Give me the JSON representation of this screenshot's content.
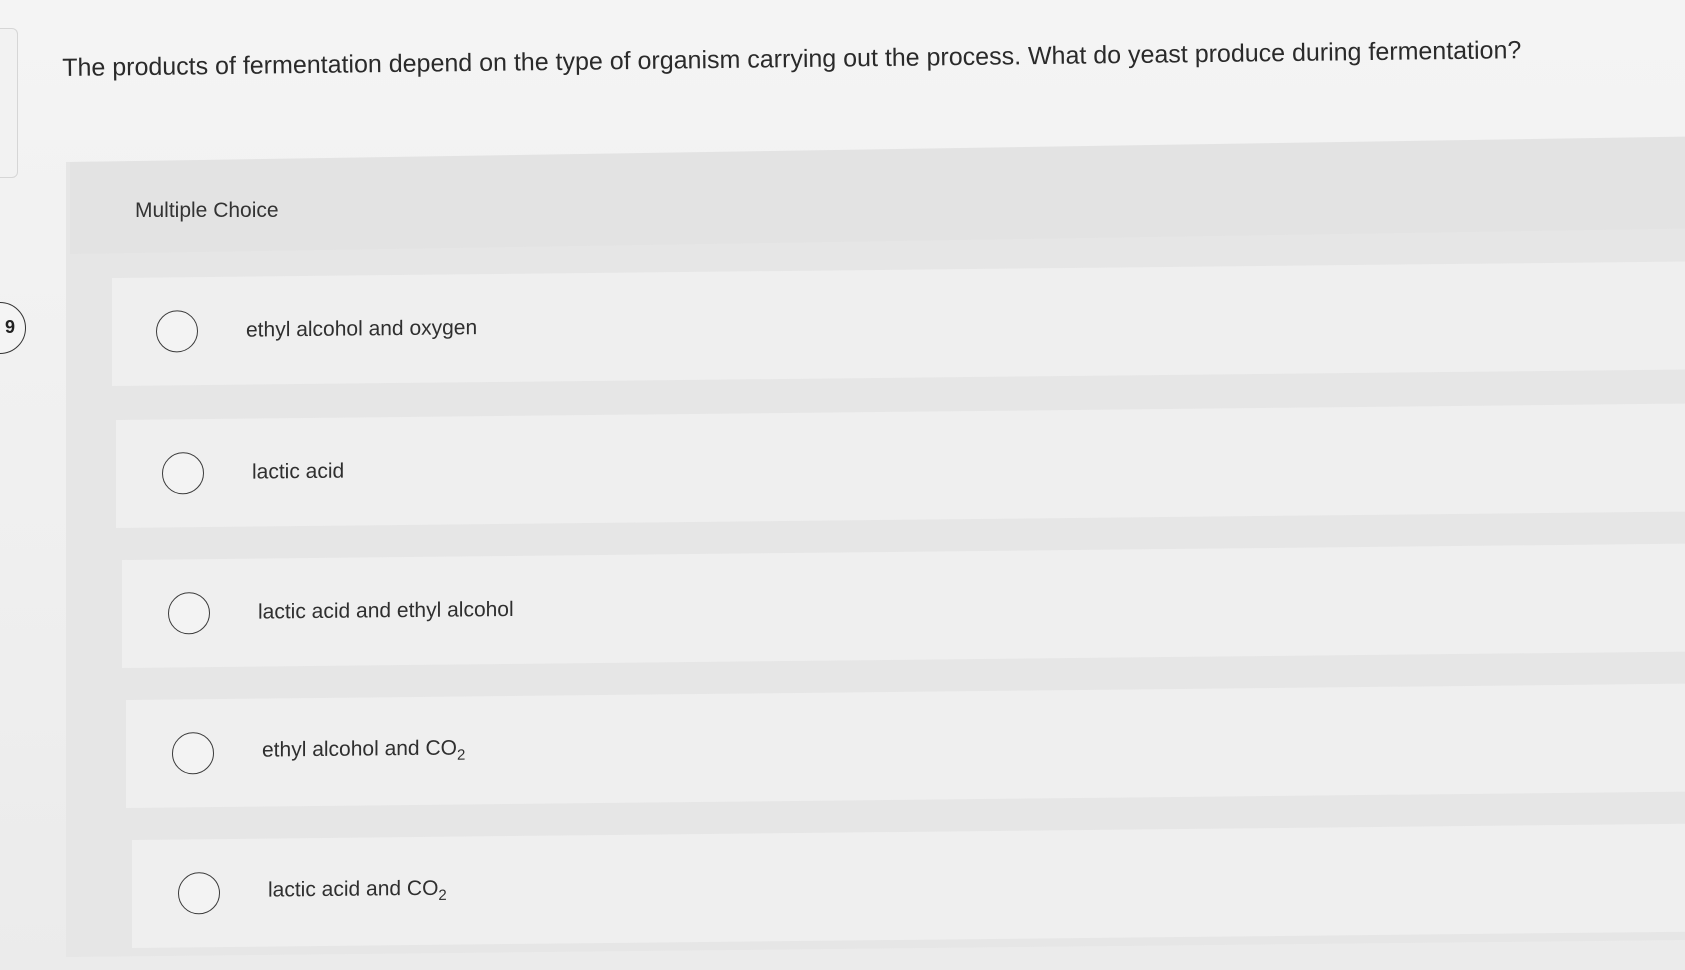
{
  "question": {
    "number": "9",
    "text": "The products of fermentation depend on the type of organism carrying out the process. What do yeast produce during fermentation?"
  },
  "answer_panel": {
    "type_label": "Multiple Choice",
    "options": [
      {
        "label": "ethyl alcohol and oxygen",
        "selected": false
      },
      {
        "label": "lactic acid",
        "selected": false
      },
      {
        "label": "lactic acid and ethyl alcohol",
        "selected": false
      },
      {
        "label_prefix": "ethyl alcohol and CO",
        "label_subscript": "2",
        "selected": false
      },
      {
        "label_prefix": "lactic acid and CO",
        "label_subscript": "2",
        "selected": false
      }
    ]
  }
}
